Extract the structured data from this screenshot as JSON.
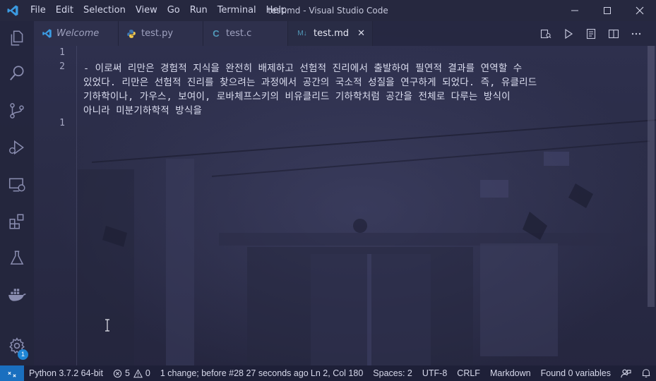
{
  "window": {
    "title": "test.md - Visual Studio Code",
    "menu": [
      "File",
      "Edit",
      "Selection",
      "View",
      "Go",
      "Run",
      "Terminal",
      "Help"
    ]
  },
  "activity_bar": {
    "items": [
      "explorer-icon",
      "search-icon",
      "source-control-icon",
      "run-debug-icon",
      "remote-explorer-icon",
      "extensions-icon",
      "testing-icon",
      "docker-icon"
    ],
    "settings_badge": "1"
  },
  "tabs": [
    {
      "label": "Welcome",
      "icon": "vscode-icon",
      "italic": true
    },
    {
      "label": "test.py",
      "icon": "python-icon"
    },
    {
      "label": "test.c",
      "icon": "c-icon",
      "icon_text": "C"
    },
    {
      "label": "test.md",
      "icon": "markdown-icon",
      "icon_text": "M↓",
      "active": true,
      "close": "✕"
    }
  ],
  "editor": {
    "line_numbers": [
      "1",
      "2",
      "1"
    ],
    "lines": [
      "- 이로써 리만은 경험적 지식을 완전히 배제하고 선험적 진리에서 출발하여 필연적 결과를 연역할 수",
      "있었다. 리만은 선험적 진리를 찾으려는 과정에서 공간의 국소적 성질을 연구하게 되었다. 즉, 유클리드",
      "기하학이나, 가우스, 보여이, 로바체프스키의 비유클리드 기하학처럼 공간을 전체로 다루는 방식이",
      "아니라 미분기하학적 방식을"
    ]
  },
  "status_bar": {
    "python": "Python 3.7.2 64-bit",
    "errors": "5",
    "warnings": "0",
    "change": "1 change; before #28  27 seconds ago",
    "position": "Ln 2, Col 180",
    "spaces": "Spaces: 2",
    "encoding": "UTF-8",
    "eol": "CRLF",
    "language": "Markdown",
    "variables": "Found 0 variables"
  },
  "colors": {
    "accent": "#1f86d4",
    "vscode_blue": "#3b9ae1",
    "python_blue": "#3d77b3",
    "python_yellow": "#f2c94c",
    "c_blue": "#519aba",
    "md_blue": "#519aba"
  }
}
